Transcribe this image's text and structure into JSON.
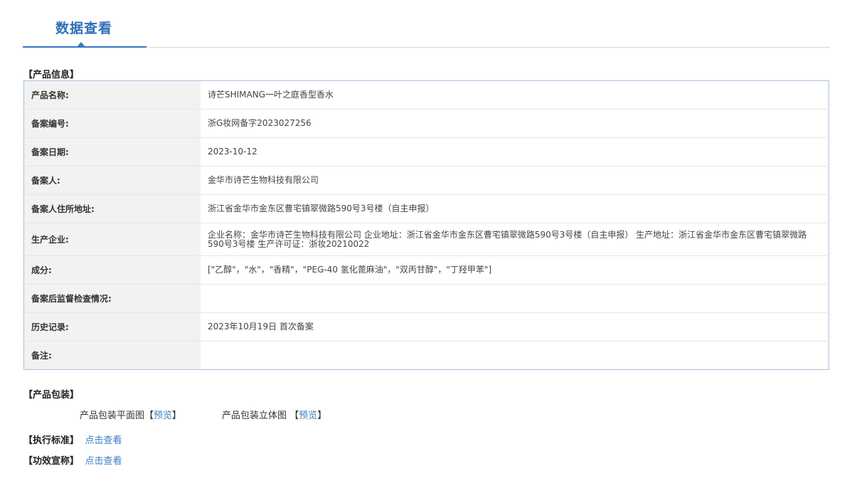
{
  "header": {
    "tab_title": "数据查看"
  },
  "product_info": {
    "section_title": "【产品信息】",
    "rows": [
      {
        "label": "产品名称:",
        "value": "诗芒SHIMANG一叶之庭香型香水"
      },
      {
        "label": "备案编号:",
        "value": "浙G妆网备字2023027256"
      },
      {
        "label": "备案日期:",
        "value": "2023-10-12"
      },
      {
        "label": "备案人:",
        "value": "金华市诗芒生物科技有限公司"
      },
      {
        "label": "备案人住所地址:",
        "value": "浙江省金华市金东区曹宅镇翠微路590号3号楼（自主申报）"
      },
      {
        "label": "生产企业:",
        "value": "企业名称：金华市诗芒生物科技有限公司 企业地址：浙江省金华市金东区曹宅镇翠微路590号3号楼（自主申报） 生产地址：浙江省金华市金东区曹宅镇翠微路590号3号楼 生产许可证：浙妆20210022"
      },
      {
        "label": "成分:",
        "value": "[\"乙醇\"，\"水\"，\"香精\"，\"PEG-40 氢化蓖麻油\"，\"双丙甘醇\"，\"丁羟甲苯\"]"
      },
      {
        "label": "备案后监督检查情况:",
        "value": ""
      },
      {
        "label": "历史记录:",
        "value": "2023年10月19日 首次备案"
      },
      {
        "label": "备注:",
        "value": ""
      }
    ]
  },
  "packaging": {
    "section_title": "【产品包装】",
    "flat_label": "产品包装平面图",
    "solid_label": "产品包装立体图",
    "bracket_open": "【",
    "bracket_close": "】",
    "preview_link": "预览"
  },
  "standard": {
    "section_title": "【执行标准】",
    "link": "点击查看"
  },
  "efficacy": {
    "section_title": "【功效宣称】",
    "link": "点击查看"
  }
}
